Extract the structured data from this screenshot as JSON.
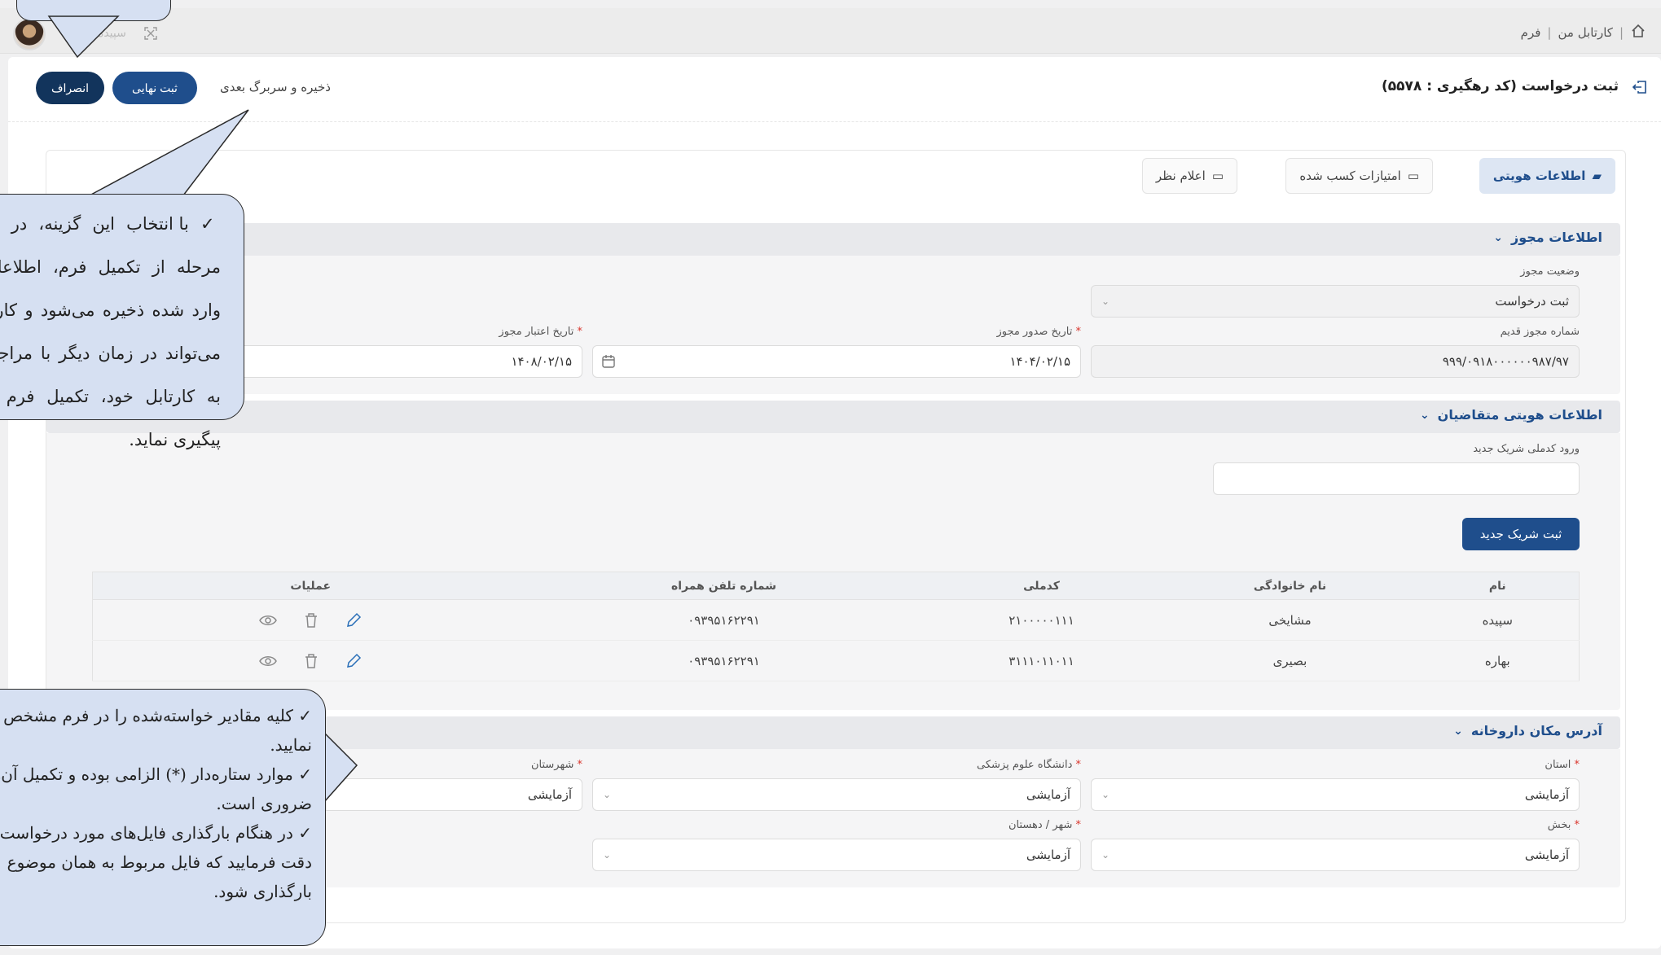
{
  "breadcrumb": {
    "home_icon": "home-icon",
    "item1": "کارتابل من",
    "separator": "|",
    "item2": "فرم"
  },
  "user": {
    "name": "سپیده"
  },
  "header": {
    "title": "ثبت درخواست (کد رهگیری : ۵۵۷۸)",
    "save_next": "ذخیره و سربرگ بعدی",
    "final_label": "ثبت نهایی",
    "cancel_label": "انصراف"
  },
  "tabs": [
    {
      "label": "اطلاعات هویتی",
      "active": true
    },
    {
      "label": "امتیازات کسب شده",
      "active": false
    },
    {
      "label": "اعلام نظر",
      "active": false
    }
  ],
  "license": {
    "title": "اطلاعات مجوز",
    "status_label": "وضعیت مجوز",
    "status_value": "ثبت درخواست",
    "old_number_label": "شماره مجوز قدیم",
    "old_number_value": "۹۹۹/۰۹۱۸۰۰۰۰۰۰۹۸۷/۹۷",
    "issue_date_label": "تاریخ صدور مجوز",
    "issue_date_value": "۱۴۰۴/۰۲/۱۵",
    "expiry_label": "تاریخ اعتبار مجوز",
    "expiry_value": "۱۴۰۸/۰۲/۱۵"
  },
  "applicants": {
    "title": "اطلاعات هویتی متقاضیان",
    "national_id_label": "ورود کدملی شریک جدید",
    "national_id_value": "",
    "add_partner_label": "ثبت شریک جدید",
    "columns": {
      "name": "نام",
      "family": "نام خانوادگی",
      "national_id": "کدملی",
      "phone": "شماره تلفن همراه",
      "ops": "عملیات"
    },
    "rows": [
      {
        "name": "سپیده",
        "family": "مشایخی",
        "national_id": "۲۱۰۰۰۰۰۱۱۱",
        "phone": "۰۹۳۹۵۱۶۲۲۹۱"
      },
      {
        "name": "بهاره",
        "family": "بصیری",
        "national_id": "۳۱۱۱۰۱۱۰۱۱",
        "phone": "۰۹۳۹۵۱۶۲۲۹۱"
      }
    ]
  },
  "address": {
    "title": "آدرس مکان داروخانه",
    "province_label": "استان",
    "province_value": "آزمایشی",
    "university_label": "دانشگاه علوم پزشکی",
    "university_value": "آزمایشی",
    "county_label": "شهرستان",
    "county_value": "آزمایشی",
    "district_label": "بخش",
    "district_value": "آزمایشی",
    "city_label": "شهر / دهستان",
    "city_value": "آزمایشی"
  },
  "callouts": {
    "save_next_tip": "با انتخاب این گزینه، در هر مرحله از تکمیل فرم، اطلاعات وارد شده ذخیره می‌شود و کاربر می‌تواند در زمان دیگر با مراجعه به کارتابل خود، تکمیل فرم را پیگیری نماید.",
    "tip1": "کلیه مقادیر خواسته‌شده را در فرم مشخص نمایید.",
    "tip2": "موارد ستاره‌دار (*) الزامی بوده و تکمیل آن‌ها ضروری است.",
    "tip3": "در هنگام بارگذاری فایل‌های مورد درخواست دقت فرمایید که فایل مربوط به همان موضوع بارگذاری شود."
  },
  "colors": {
    "primary": "#1f4e8c",
    "dark": "#12345c",
    "callout": "#d6e0f2",
    "required": "#d9342b"
  }
}
